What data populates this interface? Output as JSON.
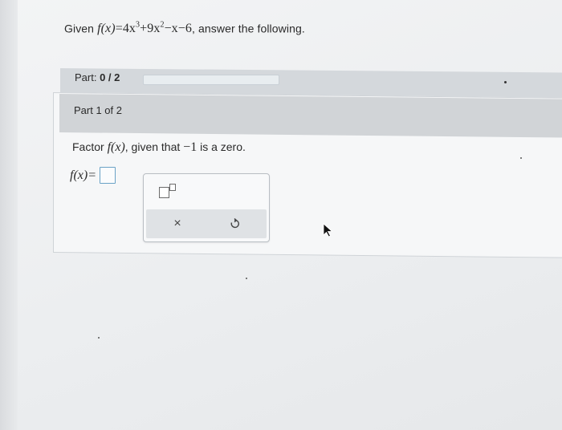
{
  "problem": {
    "given_prefix": "Given",
    "given_fx": "f(x)",
    "eq": "=",
    "term1": "4x",
    "exp1": "3",
    "term2": "+9x",
    "exp2": "2",
    "term3": "−x−6",
    "given_suffix": ", answer the following."
  },
  "progress": {
    "label": "Part:",
    "value": "0 / 2",
    "fraction": 0
  },
  "part": {
    "title": "Part 1 of 2",
    "question_prefix": "Factor",
    "question_fx": "f(x)",
    "question_middle": ", given that",
    "zero_value": "−1",
    "question_suffix": "is a zero.",
    "answer_lhs": "f(x)=",
    "answer_value": ""
  },
  "toolpanel": {
    "icons": {
      "exponent": "exponent-template-icon",
      "clear": "x-icon",
      "undo": "undo-icon"
    },
    "clear_glyph": "×"
  },
  "colors": {
    "answer_box_border": "#6aa2c6",
    "header_bar": "#d1d4d7"
  }
}
